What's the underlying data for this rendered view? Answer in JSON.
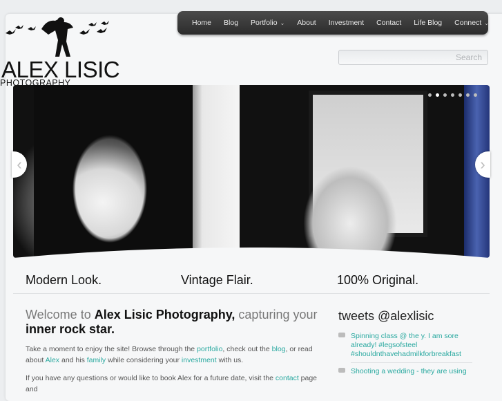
{
  "logo": {
    "name": "ALEX LISIC",
    "sub": "PHOTOGRAPHY"
  },
  "nav": {
    "items": [
      {
        "label": "Home"
      },
      {
        "label": "Blog"
      },
      {
        "label": "Portfolio",
        "dropdown": true
      },
      {
        "label": "About"
      },
      {
        "label": "Investment"
      },
      {
        "label": "Contact"
      },
      {
        "label": "Life Blog"
      },
      {
        "label": "Connect",
        "dropdown": true
      }
    ]
  },
  "search": {
    "placeholder": "Search"
  },
  "slider": {
    "slide_count": 7,
    "active_slide": 2
  },
  "taglines": {
    "t1": "Modern Look.",
    "t2": "Vintage Flair.",
    "t3": "100% Original."
  },
  "welcome": {
    "pre": "Welcome to ",
    "brand": "Alex Lisic Photography,",
    "mid": " capturing your ",
    "emph": "inner rock star."
  },
  "intro": {
    "p1_a": "Take a moment to enjoy the site! Browse through the ",
    "link_portfolio": "portfolio",
    "p1_b": ", check out the ",
    "link_blog": "blog",
    "p1_c": ", or read about ",
    "link_alex": "Alex",
    "p1_d": " and his ",
    "link_family": "family",
    "p1_e": " while considering your ",
    "link_investment": "investment",
    "p1_f": " with us.",
    "p2_a": "If you have any questions or would like to book Alex for a future date, visit the ",
    "link_contact": "contact",
    "p2_b": " page and"
  },
  "tweets": {
    "title": "tweets @alexlisic",
    "items": [
      {
        "text": "Spinning class @ the y. I am sore already! #legsofsteel #shouldnthavehadmilkforbreakfast"
      },
      {
        "text": "Shooting a wedding - they are using"
      }
    ]
  },
  "colors": {
    "accent": "#2aa9a0",
    "nav_bg": "#333333"
  }
}
